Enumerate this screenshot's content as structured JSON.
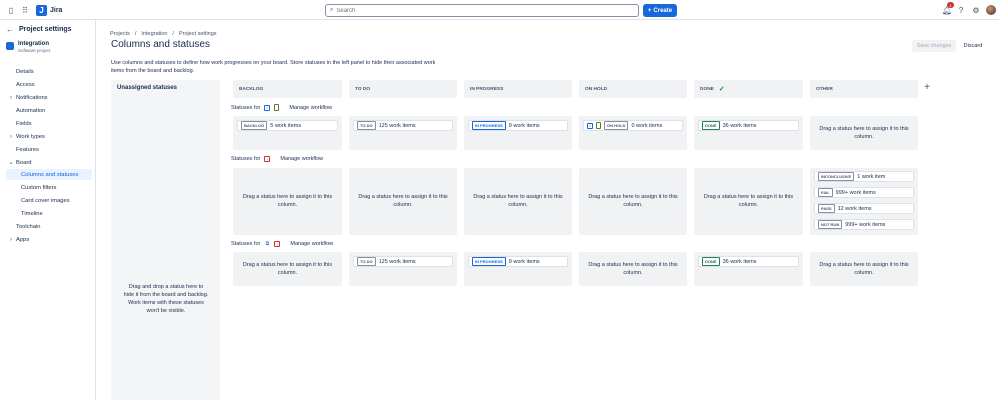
{
  "topbar": {
    "app_name": "Jira",
    "search_placeholder": "Search",
    "create_label": "Create",
    "notification_count": "1",
    "logo_letter": "J",
    "icons": [
      "sidebar-toggle-icon",
      "app-switcher-icon",
      "bell-icon",
      "help-icon",
      "settings-icon"
    ]
  },
  "sidebar": {
    "title": "Project settings",
    "project_name": "Integration",
    "project_type": "Software project",
    "items": [
      {
        "label": "Details",
        "kind": "plain"
      },
      {
        "label": "Access",
        "kind": "plain"
      },
      {
        "label": "Notifications",
        "kind": "expandable"
      },
      {
        "label": "Automation",
        "kind": "plain"
      },
      {
        "label": "Fields",
        "kind": "plain"
      },
      {
        "label": "Work types",
        "kind": "expandable"
      },
      {
        "label": "Features",
        "kind": "plain"
      },
      {
        "label": "Board",
        "kind": "expanded"
      },
      {
        "label": "Columns and statuses",
        "kind": "sub",
        "active": true
      },
      {
        "label": "Custom filters",
        "kind": "sub"
      },
      {
        "label": "Card cover images",
        "kind": "sub"
      },
      {
        "label": "Timeline",
        "kind": "sub"
      },
      {
        "label": "Toolchain",
        "kind": "plain"
      },
      {
        "label": "Apps",
        "kind": "expandable"
      }
    ]
  },
  "breadcrumb": [
    "Projects",
    "/",
    "Integration",
    "/",
    "Project settings"
  ],
  "page": {
    "title": "Columns and statuses",
    "save_label": "Save changes",
    "discard_label": "Discard",
    "description": "Use columns and statuses to define how work progresses on your board. Store statuses in the left panel to hide their associated work items from the board and backlog."
  },
  "unassigned": {
    "title": "Unassigned statuses",
    "hint": "Drag and drop a status here to hide it from the board and backlog. Work items with these statuses won't be visible."
  },
  "columns": [
    "BACKLOG",
    "TO DO",
    "IN PROGRESS",
    "ON HOLD",
    "DONE",
    "OTHER"
  ],
  "drop_text": "Drag a status here to assign it to this column.",
  "workflows": [
    {
      "label": "Statuses for",
      "link": "Manage workflow",
      "icons": [
        "checkbox-icon",
        "story-icon"
      ]
    },
    {
      "label": "Statuses for",
      "link": "Manage workflow",
      "icons": [
        "bug-icon"
      ]
    },
    {
      "label": "Statuses for",
      "link": "Manage workflow",
      "icons": [
        "subtask-icon",
        "bug-icon"
      ]
    }
  ],
  "cards": {
    "r1_backlog": {
      "status": "BACKLOG",
      "count": "5 work items"
    },
    "r1_todo": {
      "status": "TO DO",
      "count": "125 work items"
    },
    "r1_inprog": {
      "status": "IN PROGRESS",
      "count": "9 work items"
    },
    "r1_onhold": {
      "status": "ON HOLD",
      "count": "0 work items"
    },
    "r1_done": {
      "status": "DONE",
      "count": "36 work items"
    },
    "r2_other": [
      {
        "status": "INCONCLUSIVE",
        "count": "1 work item"
      },
      {
        "status": "FAIL",
        "count": "999+ work items"
      },
      {
        "status": "PASS",
        "count": "12 work items"
      },
      {
        "status": "NOT RUN",
        "count": "999+ work items"
      }
    ],
    "r3_todo": {
      "status": "TO DO",
      "count": "125 work items"
    },
    "r3_inprog": {
      "status": "IN PROGRESS",
      "count": "9 work items"
    },
    "r3_done": {
      "status": "DONE",
      "count": "36 work items"
    }
  }
}
